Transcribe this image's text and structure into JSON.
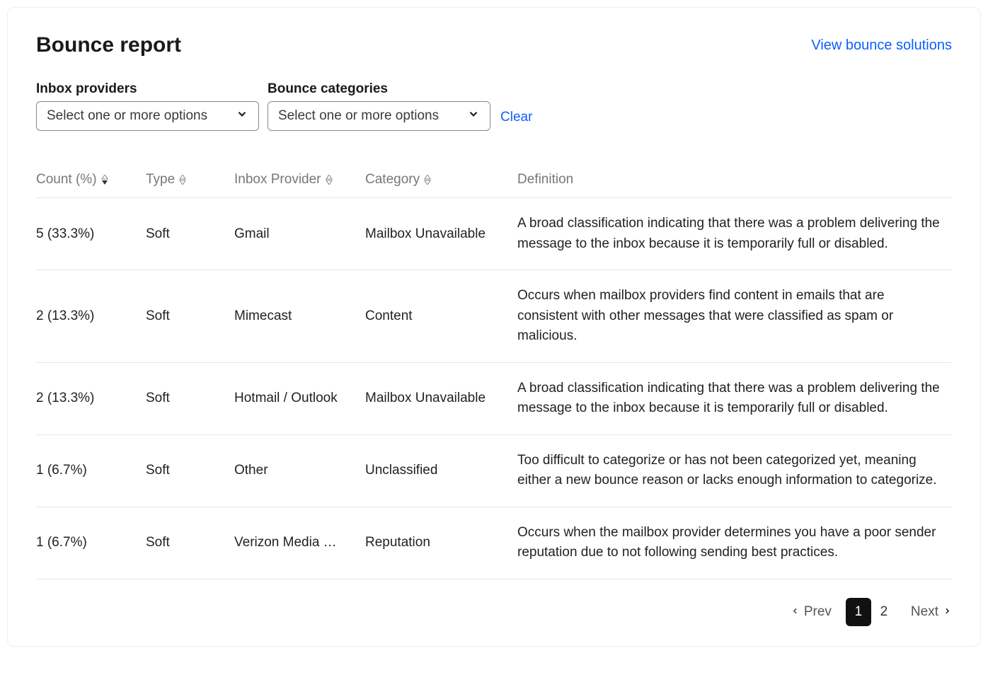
{
  "header": {
    "title": "Bounce report",
    "solutions_link": "View bounce solutions"
  },
  "filters": {
    "inbox_providers": {
      "label": "Inbox providers",
      "placeholder": "Select one or more options"
    },
    "bounce_categories": {
      "label": "Bounce categories",
      "placeholder": "Select one or more options"
    },
    "clear": "Clear"
  },
  "table": {
    "columns": {
      "count": "Count (%)",
      "type": "Type",
      "provider": "Inbox Provider",
      "category": "Category",
      "definition": "Definition"
    },
    "rows": [
      {
        "count": "5 (33.3%)",
        "type": "Soft",
        "provider": "Gmail",
        "category": "Mailbox Unavailable",
        "definition": "A broad classification indicating that there was a problem delivering the message to the inbox because it is temporarily full or disabled."
      },
      {
        "count": "2 (13.3%)",
        "type": "Soft",
        "provider": "Mimecast",
        "category": "Content",
        "definition": "Occurs when mailbox providers find content in emails that are consistent with other messages that were classified as spam or malicious."
      },
      {
        "count": "2 (13.3%)",
        "type": "Soft",
        "provider": "Hotmail / Outlook",
        "category": "Mailbox Unavailable",
        "definition": "A broad classification indicating that there was a problem delivering the message to the inbox because it is temporarily full or disabled."
      },
      {
        "count": "1 (6.7%)",
        "type": "Soft",
        "provider": "Other",
        "category": "Unclassified",
        "definition": "Too difficult to categorize or has not been categorized yet, meaning either a new bounce reason or lacks enough information to categorize."
      },
      {
        "count": "1 (6.7%)",
        "type": "Soft",
        "provider": "Verizon Media …",
        "category": "Reputation",
        "definition": "Occurs when the mailbox provider determines you have a poor sender reputation due to not following sending best practices."
      }
    ]
  },
  "pagination": {
    "prev": "Prev",
    "next": "Next",
    "pages": [
      "1",
      "2"
    ],
    "active": "1"
  }
}
